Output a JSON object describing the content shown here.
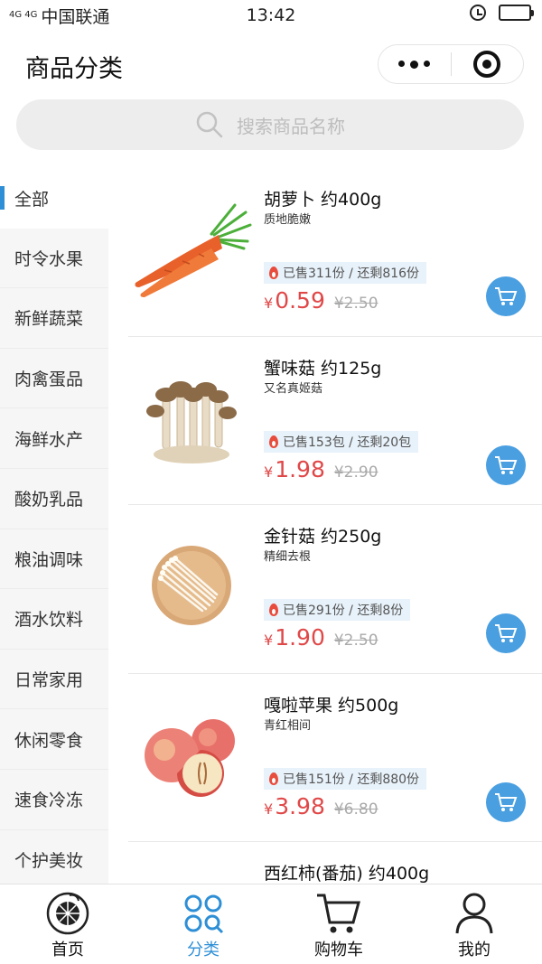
{
  "status_bar": {
    "signal": "4G 4G",
    "carrier": "中国联通",
    "time": "13:42",
    "alarm_icon": "alarm-icon",
    "battery_icon": "battery-icon"
  },
  "nav": {
    "title": "商品分类",
    "more_icon": "more-dots-icon",
    "close_icon": "target-close-icon"
  },
  "search": {
    "placeholder": "搜索商品名称",
    "icon": "search-icon"
  },
  "categories": [
    {
      "label": "全部",
      "active": true
    },
    {
      "label": "时令水果"
    },
    {
      "label": "新鲜蔬菜"
    },
    {
      "label": "肉禽蛋品"
    },
    {
      "label": "海鲜水产"
    },
    {
      "label": "酸奶乳品"
    },
    {
      "label": "粮油调味"
    },
    {
      "label": "酒水饮料"
    },
    {
      "label": "日常家用"
    },
    {
      "label": "休闲零食"
    },
    {
      "label": "速食冷冻"
    },
    {
      "label": "个护美妆"
    }
  ],
  "products": [
    {
      "name": "胡萝卜 约400g",
      "desc": "质地脆嫩",
      "stock": "已售311份 / 还剩816份",
      "currency": "¥",
      "price": "0.59",
      "old_price": "¥2.50",
      "image": "carrot"
    },
    {
      "name": "蟹味菇 约125g",
      "desc": "又名真姬菇",
      "stock": "已售153包 / 还剩20包",
      "currency": "¥",
      "price": "1.98",
      "old_price": "¥2.90",
      "image": "mushroom"
    },
    {
      "name": "金针菇 约250g",
      "desc": "精细去根",
      "stock": "已售291份 / 还剩8份",
      "currency": "¥",
      "price": "1.90",
      "old_price": "¥2.50",
      "image": "enoki"
    },
    {
      "name": "嘎啦苹果 约500g",
      "desc": "青红相间",
      "stock": "已售151份 / 还剩880份",
      "currency": "¥",
      "price": "3.98",
      "old_price": "¥6.80",
      "image": "apple"
    },
    {
      "name": "西红柿(番茄) 约400g",
      "desc": "",
      "stock": "",
      "currency": "",
      "price": "",
      "old_price": "",
      "image": ""
    }
  ],
  "tabbar": [
    {
      "label": "首页",
      "icon": "home-fruit-icon"
    },
    {
      "label": "分类",
      "icon": "category-grid-icon",
      "active": true
    },
    {
      "label": "购物车",
      "icon": "shopping-cart-icon"
    },
    {
      "label": "我的",
      "icon": "user-profile-icon"
    }
  ],
  "colors": {
    "accent": "#2e8fd6",
    "price": "#e04848",
    "cart_button": "#4a9fe1"
  }
}
